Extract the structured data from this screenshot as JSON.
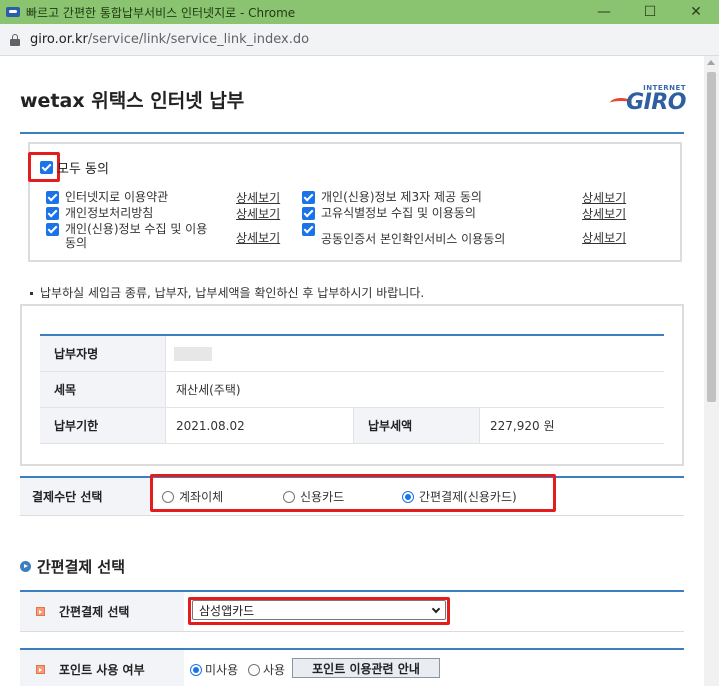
{
  "window": {
    "title": "빠르고 간편한 통합납부서비스 인터넷지로 - Chrome",
    "url_host": "giro.or.kr",
    "url_path": "/service/link/service_link_index.do",
    "minimize": "—",
    "maximize": "☐",
    "close": "✕"
  },
  "header": {
    "title": "wetax 위택스 인터넷 납부",
    "logo_small": "INTERNET",
    "logo_big": "GIRO"
  },
  "agreement": {
    "all_label": "모두 동의",
    "all_checked": true,
    "items_left": [
      {
        "label": "인터넷지로 이용약관",
        "link": "상세보기",
        "checked": true
      },
      {
        "label": "개인정보처리방침",
        "link": "상세보기",
        "checked": true
      },
      {
        "label": "개인(신용)정보 수집 및 이용",
        "label2": "동의",
        "link": "상세보기",
        "checked": true
      }
    ],
    "items_right": [
      {
        "label": "개인(신용)정보 제3자 제공 동의",
        "link": "상세보기",
        "checked": true
      },
      {
        "label": "고유식별정보 수집 및 이용동의",
        "link": "상세보기",
        "checked": true
      },
      {
        "label": "공동인증서 본인확인서비스 이용동의",
        "link": "상세보기",
        "checked": true
      }
    ]
  },
  "notice": "납부하실 세입금 종류, 납부자, 납부세액을 확인하신 후 납부하시기 바랍니다.",
  "info": {
    "payer_label": "납부자명",
    "tax_item_label": "세목",
    "tax_item_value": "재산세(주택)",
    "due_label": "납부기한",
    "due_value": "2021.08.02",
    "amount_label": "납부세액",
    "amount_value": "227,920 원"
  },
  "payment": {
    "label": "결제수단 선택",
    "options": [
      {
        "label": "계좌이체",
        "selected": false
      },
      {
        "label": "신용카드",
        "selected": false
      },
      {
        "label": "간편결제(신용카드)",
        "selected": true
      }
    ]
  },
  "easy_pay": {
    "section_title": "간편결제 선택",
    "select_label": "간편결제 선택",
    "select_value": "삼성앱카드",
    "point_label": "포인트 사용 여부",
    "point_options": [
      {
        "label": "미사용",
        "selected": true
      },
      {
        "label": "사용",
        "selected": false
      }
    ],
    "point_button": "포인트 이용관련 안내"
  }
}
